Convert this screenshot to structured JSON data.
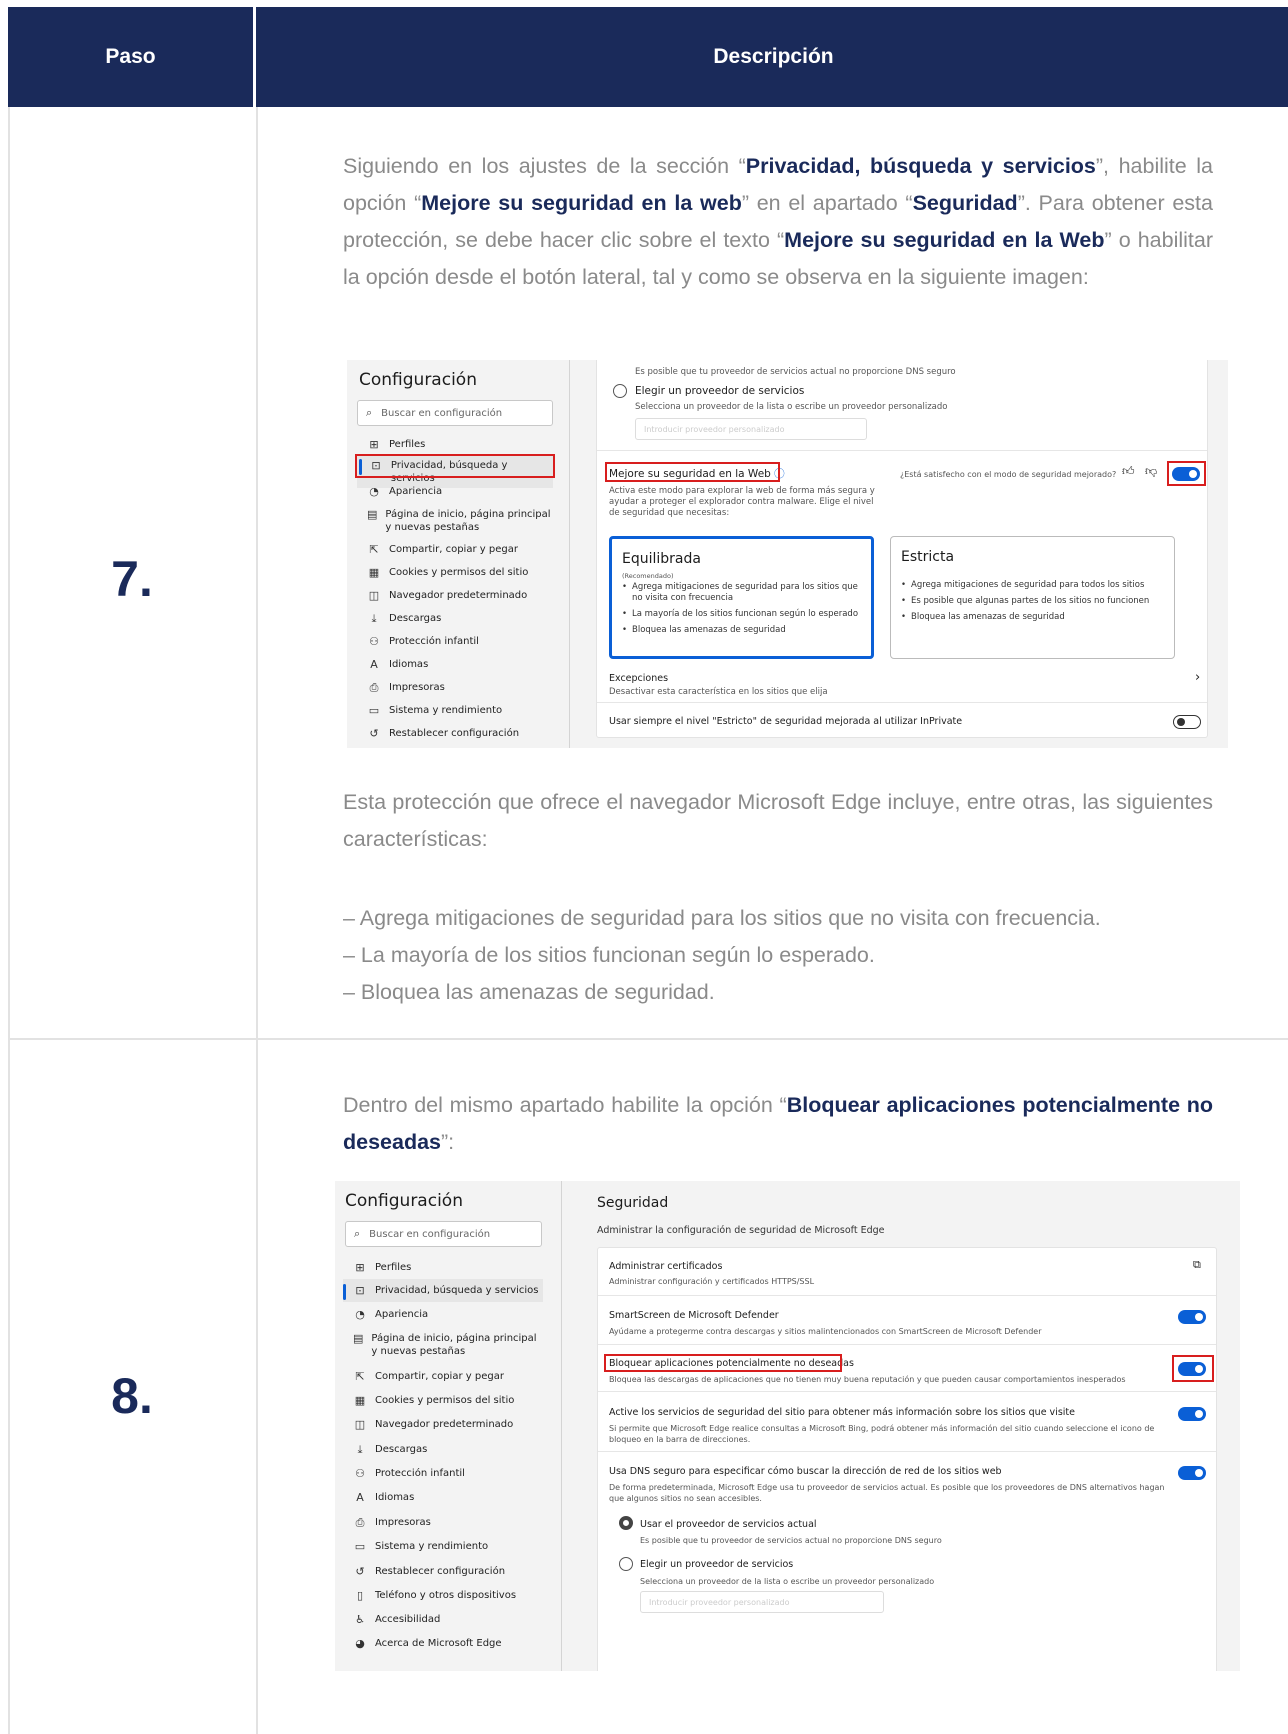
{
  "header": {
    "col_step": "Paso",
    "col_desc": "Descripción"
  },
  "step7": {
    "number": "7.",
    "intro_parts": [
      "Siguiendo en los ajustes de la sección “",
      "Privacidad, búsqueda y servicios",
      "”, habilite la opción “",
      "Mejore su seguridad en la web",
      "” en el apartado “",
      "Seguridad",
      "”. Para obtener esta protección, se debe hacer clic sobre el texto “",
      "Mejore su seguridad en la Web",
      "” o habilitar la opción desde el botón lateral, tal y como se observa en la siguiente imagen:"
    ],
    "after_text": "Esta protección que ofrece el navegador Microsoft Edge incluye, entre otras, las siguientes características:",
    "features": [
      "– Agrega mitigaciones de seguridad para los sitios que no visita con frecuencia.",
      "– La mayoría de los sitios funcionan según lo esperado.",
      "– Bloquea las amenazas de seguridad."
    ],
    "shot": {
      "title": "Configuración",
      "search_placeholder": "Buscar en configuración",
      "menu": [
        "Perfiles",
        "Privacidad, búsqueda y servicios",
        "Apariencia",
        "Página de inicio, página principal y nuevas pestañas",
        "Compartir, copiar y pegar",
        "Cookies y permisos del sitio",
        "Navegador predeterminado",
        "Descargas",
        "Protección infantil",
        "Idiomas",
        "Impresoras",
        "Sistema y rendimiento",
        "Restablecer configuración"
      ],
      "dns_note": "Es posible que tu proveedor de servicios actual no proporcione DNS seguro",
      "provider_label": "Elegir un proveedor de servicios",
      "provider_desc": "Selecciona un proveedor de la lista o escribe un proveedor personalizado",
      "provider_placeholder": "Introducir proveedor personalizado",
      "enhance_label": "Mejore su seguridad en la Web",
      "feedback_q": "¿Está satisfecho con el modo de seguridad mejorado?",
      "enhance_desc": "Activa este modo para explorar la web de forma más segura y ayudar a proteger el explorador contra malware. Elige el nivel de seguridad que necesitas:",
      "balanced": {
        "title": "Equilibrada",
        "sub": "(Recomendado)",
        "items": [
          "Agrega mitigaciones de seguridad para los sitios que no visita con frecuencia",
          "La mayoría de los sitios funcionan según lo esperado",
          "Bloquea las amenazas de seguridad"
        ]
      },
      "strict": {
        "title": "Estricta",
        "items": [
          "Agrega mitigaciones de seguridad para todos los sitios",
          "Es posible que algunas partes de los sitios no funcionen",
          "Bloquea las amenazas de seguridad"
        ]
      },
      "exceptions_label": "Excepciones",
      "exceptions_desc": "Desactivar esta característica en los sitios que elija",
      "inprivate_label": "Usar siempre el nivel \"Estricto\" de seguridad mejorada al utilizar InPrivate",
      "inprivate_on": false,
      "enhance_on": true
    }
  },
  "step8": {
    "number": "8.",
    "intro_parts": [
      "Dentro del mismo apartado habilite la opción “",
      "Bloquear aplicaciones potencialmente no deseadas",
      "”:"
    ],
    "shot": {
      "title": "Configuración",
      "search_placeholder": "Buscar en configuración",
      "menu": [
        "Perfiles",
        "Privacidad, búsqueda y servicios",
        "Apariencia",
        "Página de inicio, página principal y nuevas pestañas",
        "Compartir, copiar y pegar",
        "Cookies y permisos del sitio",
        "Navegador predeterminado",
        "Descargas",
        "Protección infantil",
        "Idiomas",
        "Impresoras",
        "Sistema y rendimiento",
        "Restablecer configuración",
        "Teléfono y otros dispositivos",
        "Accesibilidad",
        "Acerca de Microsoft Edge"
      ],
      "section_title": "Seguridad",
      "section_desc": "Administrar la configuración de seguridad de Microsoft Edge",
      "rows": [
        {
          "label": "Administrar certificados",
          "desc": "Administrar configuración y certificados HTTPS/SSL",
          "control": "external"
        },
        {
          "label": "SmartScreen de Microsoft Defender",
          "desc": "Ayúdame a protegerme contra descargas y sitios malintencionados con SmartScreen de Microsoft Defender",
          "control": "on"
        },
        {
          "label": "Bloquear aplicaciones potencialmente no deseadas",
          "desc": "Bloquea las descargas de aplicaciones que no tienen muy buena reputación y que pueden causar comportamientos inesperados",
          "control": "on"
        },
        {
          "label": "Active los servicios de seguridad del sitio para obtener más información sobre los sitios que visite",
          "desc": "Si permite que Microsoft Edge realice consultas a Microsoft Bing, podrá obtener más información del sitio cuando seleccione el icono de bloqueo en la barra de direcciones.",
          "control": "on"
        },
        {
          "label": "Usa DNS seguro para especificar cómo buscar la dirección de red de los sitios web",
          "desc": "De forma predeterminada, Microsoft Edge usa tu proveedor de servicios actual. Es posible que los proveedores de DNS alternativos hagan que algunos sitios no sean accesibles.",
          "control": "on"
        }
      ],
      "dns_current_label": "Usar el proveedor de servicios actual",
      "dns_current_desc": "Es posible que tu proveedor de servicios actual no proporcione DNS seguro",
      "provider_label": "Elegir un proveedor de servicios",
      "provider_desc": "Selecciona un proveedor de la lista o escribe un proveedor personalizado",
      "provider_placeholder": "Introducir proveedor personalizado"
    }
  }
}
